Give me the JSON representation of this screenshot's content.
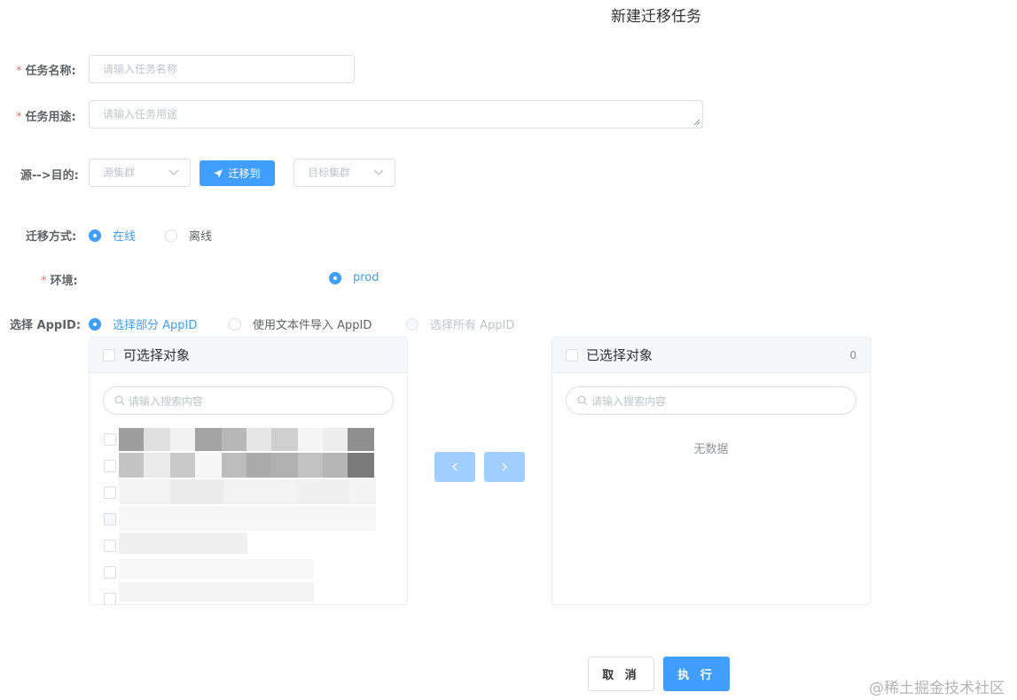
{
  "title": "新建迁移任务",
  "form": {
    "task_name": {
      "label": "任务名称:",
      "required_mark": "*",
      "placeholder": "请输入任务名称"
    },
    "task_purpose": {
      "label": "任务用途:",
      "required_mark": "*",
      "placeholder": "请输入任务用途"
    },
    "route": {
      "label": "源-->目的:",
      "source_placeholder": "源集群",
      "migrate_button": "迁移到",
      "target_placeholder": "目标集群"
    },
    "mode": {
      "label": "迁移方式:",
      "options": [
        "在线",
        "离线"
      ],
      "selected": "在线"
    },
    "env": {
      "label": "环境:",
      "required_mark": "*",
      "options": [
        "prod"
      ],
      "selected": "prod"
    },
    "appid": {
      "label": "选择 AppID:",
      "options": [
        "选择部分 AppID",
        "使用文本件导入 AppID",
        "选择所有 AppID"
      ],
      "selected": "选择部分 AppID",
      "disabled": [
        "选择所有 AppID"
      ]
    }
  },
  "transfer": {
    "left": {
      "title": "可选择对象",
      "search_placeholder": "请输入搜索内容",
      "visible_item_count": 7
    },
    "right": {
      "title": "已选择对象",
      "count": "0",
      "search_placeholder": "请输入搜索内容",
      "empty_text": "无数据"
    },
    "to_left_icon": "chevron-left-icon",
    "to_right_icon": "chevron-right-icon"
  },
  "actions": {
    "cancel": "取 消",
    "execute": "执 行"
  },
  "watermark": "@稀土掘金技术社区",
  "colors": {
    "primary": "#409eff",
    "primary_disabled": "#a0cfff",
    "required": "#f56c6c",
    "border": "#dcdfe6"
  }
}
